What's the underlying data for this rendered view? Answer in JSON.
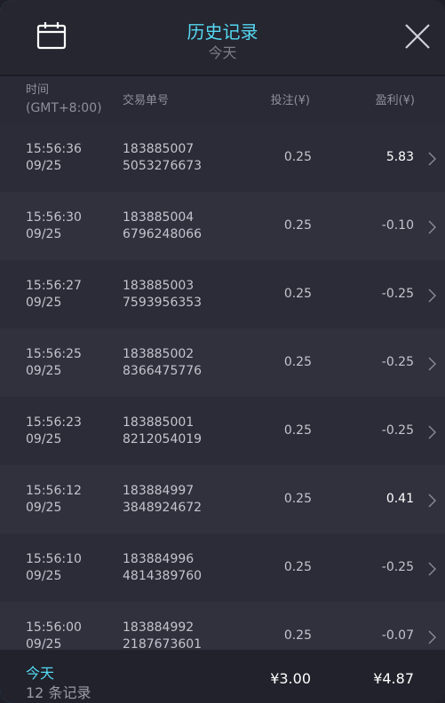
{
  "header": {
    "title": "历史记录",
    "subtitle": "今天"
  },
  "columns": {
    "time_line1": "时间",
    "time_line2": "(GMT+8:00)",
    "trade_id": "交易单号",
    "bet": "投注(¥)",
    "profit": "盈利(¥)"
  },
  "rows": [
    {
      "time": "15:56:36",
      "date": "09/25",
      "id_line1": "183885007",
      "id_line2": "5053276673",
      "bet": "0.25",
      "profit": "5.83",
      "positive": true
    },
    {
      "time": "15:56:30",
      "date": "09/25",
      "id_line1": "183885004",
      "id_line2": "6796248066",
      "bet": "0.25",
      "profit": "-0.10",
      "positive": false
    },
    {
      "time": "15:56:27",
      "date": "09/25",
      "id_line1": "183885003",
      "id_line2": "7593956353",
      "bet": "0.25",
      "profit": "-0.25",
      "positive": false
    },
    {
      "time": "15:56:25",
      "date": "09/25",
      "id_line1": "183885002",
      "id_line2": "8366475776",
      "bet": "0.25",
      "profit": "-0.25",
      "positive": false
    },
    {
      "time": "15:56:23",
      "date": "09/25",
      "id_line1": "183885001",
      "id_line2": "8212054019",
      "bet": "0.25",
      "profit": "-0.25",
      "positive": false
    },
    {
      "time": "15:56:12",
      "date": "09/25",
      "id_line1": "183884997",
      "id_line2": "3848924672",
      "bet": "0.25",
      "profit": "0.41",
      "positive": true
    },
    {
      "time": "15:56:10",
      "date": "09/25",
      "id_line1": "183884996",
      "id_line2": "4814389760",
      "bet": "0.25",
      "profit": "-0.25",
      "positive": false
    },
    {
      "time": "15:56:00",
      "date": "09/25",
      "id_line1": "183884992",
      "id_line2": "2187673601",
      "bet": "0.25",
      "profit": "-0.07",
      "positive": false
    }
  ],
  "footer": {
    "period": "今天",
    "count": "12 条记录",
    "total_bet": "¥3.00",
    "total_profit": "¥4.87"
  },
  "colors": {
    "accent": "#55d8f2",
    "positive_profit": "#ffffff"
  },
  "icons": [
    "calendar-icon",
    "close-icon",
    "chevron-right-icon"
  ]
}
